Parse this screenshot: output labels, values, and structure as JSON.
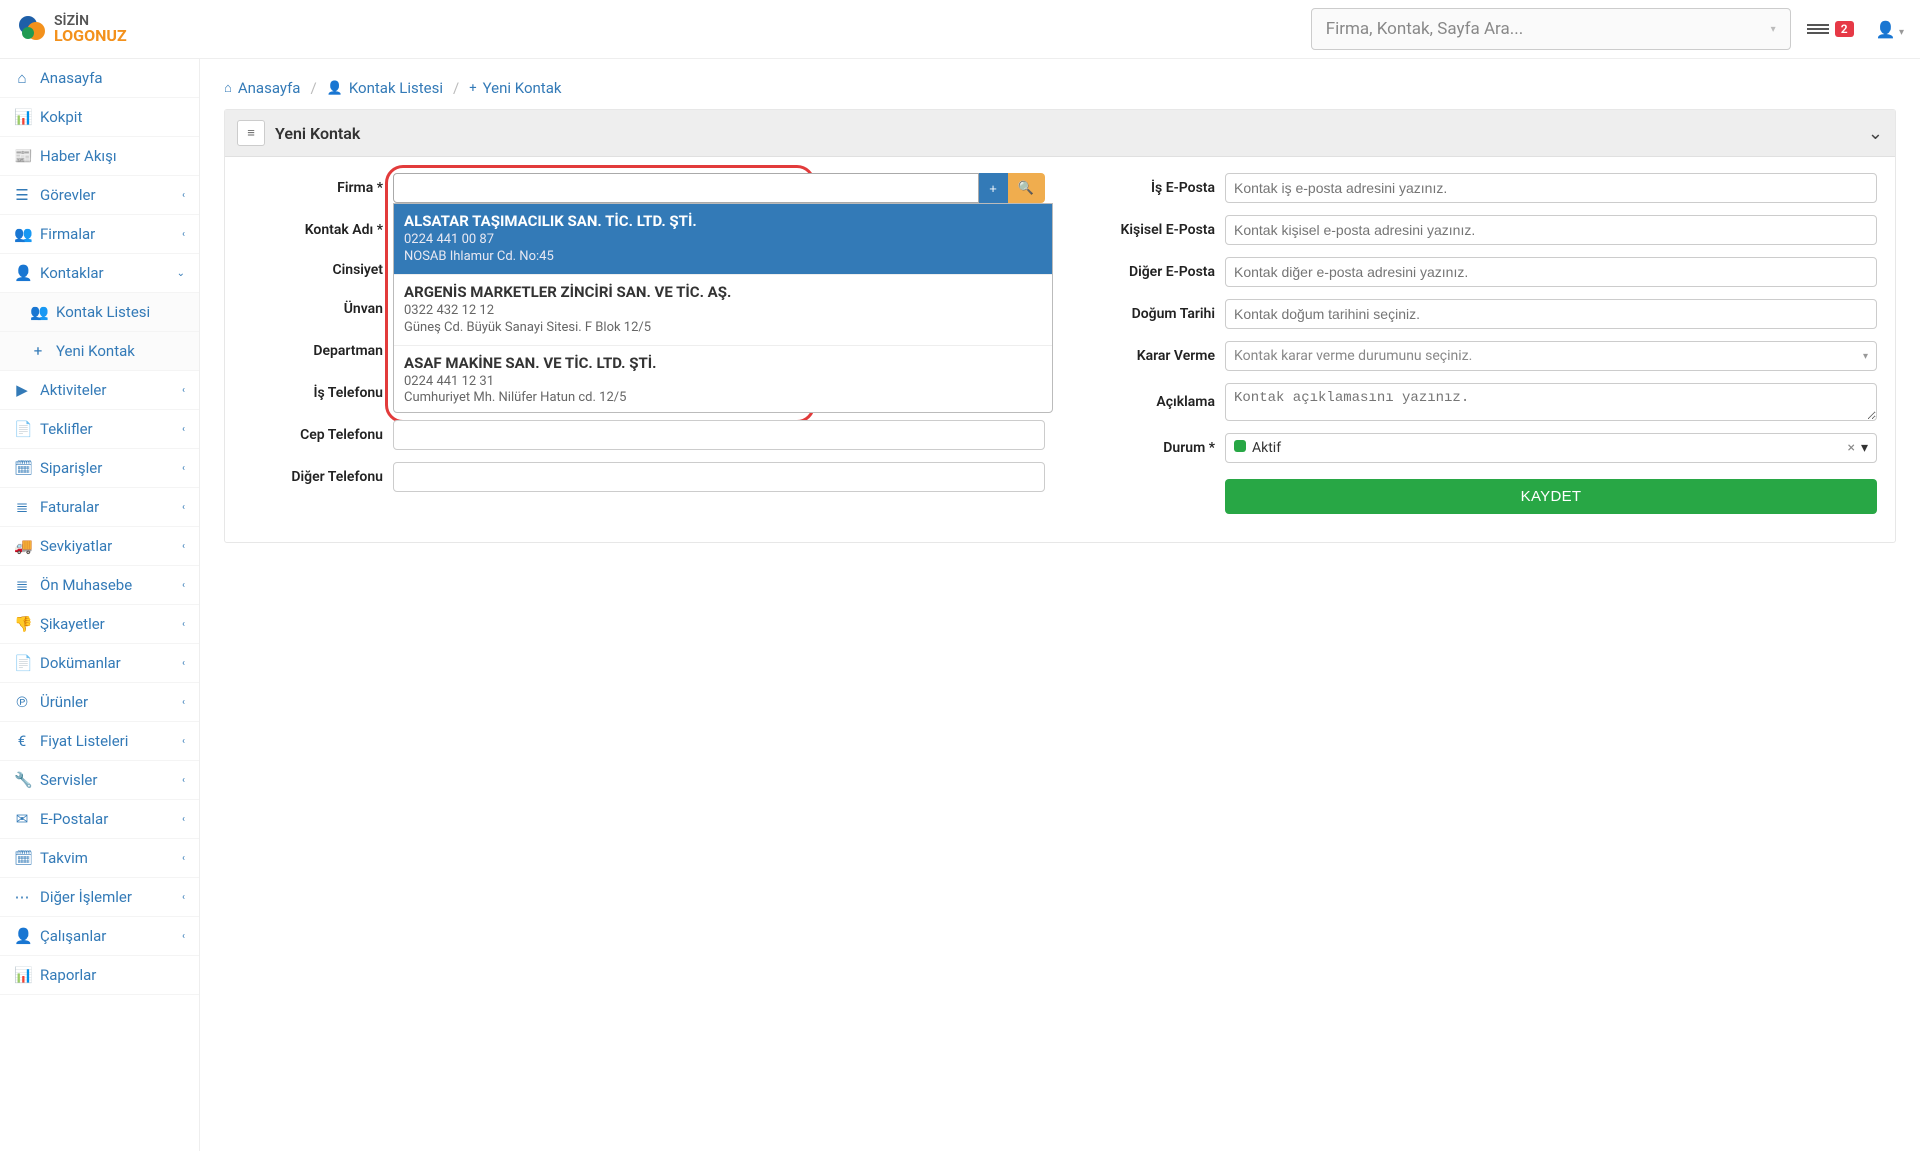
{
  "header": {
    "logo_line1": "SİZİN",
    "logo_line2": "LOGONUZ",
    "search_placeholder": "Firma, Kontak, Sayfa Ara...",
    "badge_count": "2"
  },
  "sidebar": {
    "items": [
      {
        "icon": "home",
        "label": "Anasayfa",
        "chev": false,
        "open": false
      },
      {
        "icon": "dash",
        "label": "Kokpit",
        "chev": false,
        "open": false
      },
      {
        "icon": "news",
        "label": "Haber Akışı",
        "chev": false,
        "open": false
      },
      {
        "icon": "tasks",
        "label": "Görevler",
        "chev": true,
        "open": false
      },
      {
        "icon": "group",
        "label": "Firmalar",
        "chev": true,
        "open": false
      },
      {
        "icon": "user",
        "label": "Kontaklar",
        "chev": true,
        "open": true
      },
      {
        "icon": "video",
        "label": "Aktiviteler",
        "chev": true,
        "open": false
      },
      {
        "icon": "file",
        "label": "Teklifler",
        "chev": true,
        "open": false
      },
      {
        "icon": "cal",
        "label": "Siparişler",
        "chev": true,
        "open": false
      },
      {
        "icon": "list",
        "label": "Faturalar",
        "chev": true,
        "open": false
      },
      {
        "icon": "truck",
        "label": "Sevkiyatlar",
        "chev": true,
        "open": false
      },
      {
        "icon": "list",
        "label": "Ön Muhasebe",
        "chev": true,
        "open": false
      },
      {
        "icon": "thumb",
        "label": "Şikayetler",
        "chev": true,
        "open": false
      },
      {
        "icon": "doc",
        "label": "Dokümanlar",
        "chev": true,
        "open": false
      },
      {
        "icon": "prod",
        "label": "Ürünler",
        "chev": true,
        "open": false
      },
      {
        "icon": "euro",
        "label": "Fiyat Listeleri",
        "chev": true,
        "open": false
      },
      {
        "icon": "wrench",
        "label": "Servisler",
        "chev": true,
        "open": false
      },
      {
        "icon": "mail",
        "label": "E-Postalar",
        "chev": true,
        "open": false
      },
      {
        "icon": "cal2",
        "label": "Takvim",
        "chev": true,
        "open": false
      },
      {
        "icon": "other",
        "label": "Diğer İşlemler",
        "chev": true,
        "open": false
      },
      {
        "icon": "user",
        "label": "Çalışanlar",
        "chev": true,
        "open": false
      },
      {
        "icon": "chart",
        "label": "Raporlar",
        "chev": false,
        "open": false
      }
    ],
    "sub_items": [
      {
        "icon": "group",
        "label": "Kontak Listesi"
      },
      {
        "icon": "plus",
        "label": "Yeni Kontak"
      }
    ]
  },
  "breadcrumb": {
    "home": "Anasayfa",
    "list": "Kontak Listesi",
    "new": "Yeni Kontak"
  },
  "panel": {
    "title": "Yeni Kontak"
  },
  "form": {
    "left": {
      "firma": "Firma *",
      "kontak_adi": "Kontak Adı *",
      "cinsiyet": "Cinsiyet",
      "unvan": "Ünvan",
      "departman": "Departman",
      "is_telefonu": "İş Telefonu",
      "cep_telefonu": "Cep Telefonu",
      "diger_telefonu": "Diğer Telefonu"
    },
    "right": {
      "is_eposta": "İş E-Posta",
      "kisisel_eposta": "Kişisel E-Posta",
      "diger_eposta": "Diğer E-Posta",
      "dogum": "Doğum Tarihi",
      "karar": "Karar Verme",
      "aciklama": "Açıklama",
      "durum": "Durum *"
    },
    "placeholders": {
      "is_eposta": "Kontak iş e-posta adresini yazınız.",
      "kisisel_eposta": "Kontak kişisel e-posta adresini yazınız.",
      "diger_eposta": "Kontak diğer e-posta adresini yazınız.",
      "dogum": "Kontak doğum tarihini seçiniz.",
      "karar": "Kontak karar verme durumunu seçiniz.",
      "aciklama": "Kontak açıklamasını yazınız."
    },
    "durum_value": "Aktif",
    "save": "KAYDET"
  },
  "dropdown": {
    "items": [
      {
        "name": "ALSATAR TAŞIMACILIK SAN. TİC. LTD. ŞTİ.",
        "phone": "0224 441 00 87",
        "addr": "NOSAB Ihlamur Cd. No:45",
        "selected": true
      },
      {
        "name": "ARGENİS MARKETLER ZİNCİRİ SAN. VE TİC. AŞ.",
        "phone": "0322 432 12 12",
        "addr": "Güneş Cd. Büyük Sanayi Sitesi. F Blok 12/5",
        "selected": false
      },
      {
        "name": "ASAF MAKİNE SAN. VE TİC. LTD. ŞTİ.",
        "phone": "0224 441 12 31",
        "addr": "Cumhuriyet Mh. Nilüfer Hatun cd. 12/5",
        "selected": false
      }
    ]
  },
  "icons": {
    "home": "⌂",
    "dash": "📊",
    "news": "📰",
    "tasks": "☰",
    "group": "👥",
    "user": "👤",
    "video": "▶",
    "file": "📄",
    "cal": "🗓",
    "list": "≣",
    "truck": "🚚",
    "thumb": "👎",
    "doc": "📄",
    "prod": "℗",
    "euro": "€",
    "wrench": "🔧",
    "mail": "✉",
    "cal2": "🗓",
    "other": "⋯",
    "chart": "📊",
    "plus": "+",
    "search": "🔍",
    "chev_left": "‹",
    "chev_down": "⌄",
    "menu": "≡",
    "caret": "▾",
    "check": "✓",
    "x": "×"
  }
}
